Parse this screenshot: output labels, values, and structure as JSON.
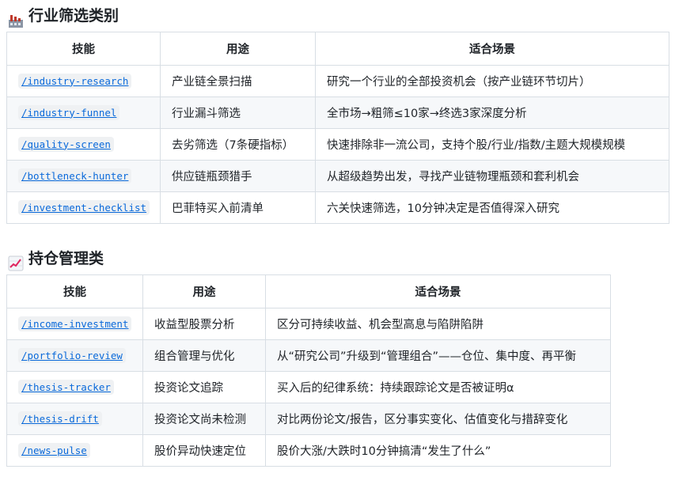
{
  "sections": [
    {
      "icon": "factory-icon",
      "title": "行业筛选类别",
      "headers": [
        "技能",
        "用途",
        "适合场景"
      ],
      "rows": [
        {
          "skill": "/industry-research",
          "purpose": "产业链全景扫描",
          "scenario": "研究一个行业的全部投资机会（按产业链环节切片）"
        },
        {
          "skill": "/industry-funnel",
          "purpose": "行业漏斗筛选",
          "scenario": "全市场→粗筛≤10家→终选3家深度分析"
        },
        {
          "skill": "/quality-screen",
          "purpose": "去劣筛选（7条硬指标）",
          "scenario": "快速排除非一流公司，支持个股/行业/指数/主题大规模规模"
        },
        {
          "skill": "/bottleneck-hunter",
          "purpose": "供应链瓶颈猎手",
          "scenario": "从超级趋势出发，寻找产业链物理瓶颈和套利机会"
        },
        {
          "skill": "/investment-checklist",
          "purpose": "巴菲特买入前清单",
          "scenario": "六关快速筛选，10分钟决定是否值得深入研究"
        }
      ]
    },
    {
      "icon": "chart-increasing-icon",
      "title": "持仓管理类",
      "headers": [
        "技能",
        "用途",
        "适合场景"
      ],
      "rows": [
        {
          "skill": "/income-investment",
          "purpose": "收益型股票分析",
          "scenario": "区分可持续收益、机会型高息与陷阱陷阱"
        },
        {
          "skill": "/portfolio-review",
          "purpose": "组合管理与优化",
          "scenario": "从“研究公司”升级到“管理组合”——仓位、集中度、再平衡"
        },
        {
          "skill": "/thesis-tracker",
          "purpose": "投资论文追踪",
          "scenario": "买入后的纪律系统：持续跟踪论文是否被证明α"
        },
        {
          "skill": "/thesis-drift",
          "purpose": "投资论文尚未检测",
          "scenario": "对比两份论文/报告，区分事实变化、估值变化与措辞变化"
        },
        {
          "skill": "/news-pulse",
          "purpose": "股价异动快速定位",
          "scenario": "股价大涨/大跌时10分钟搞清“发生了什么”"
        }
      ]
    }
  ]
}
